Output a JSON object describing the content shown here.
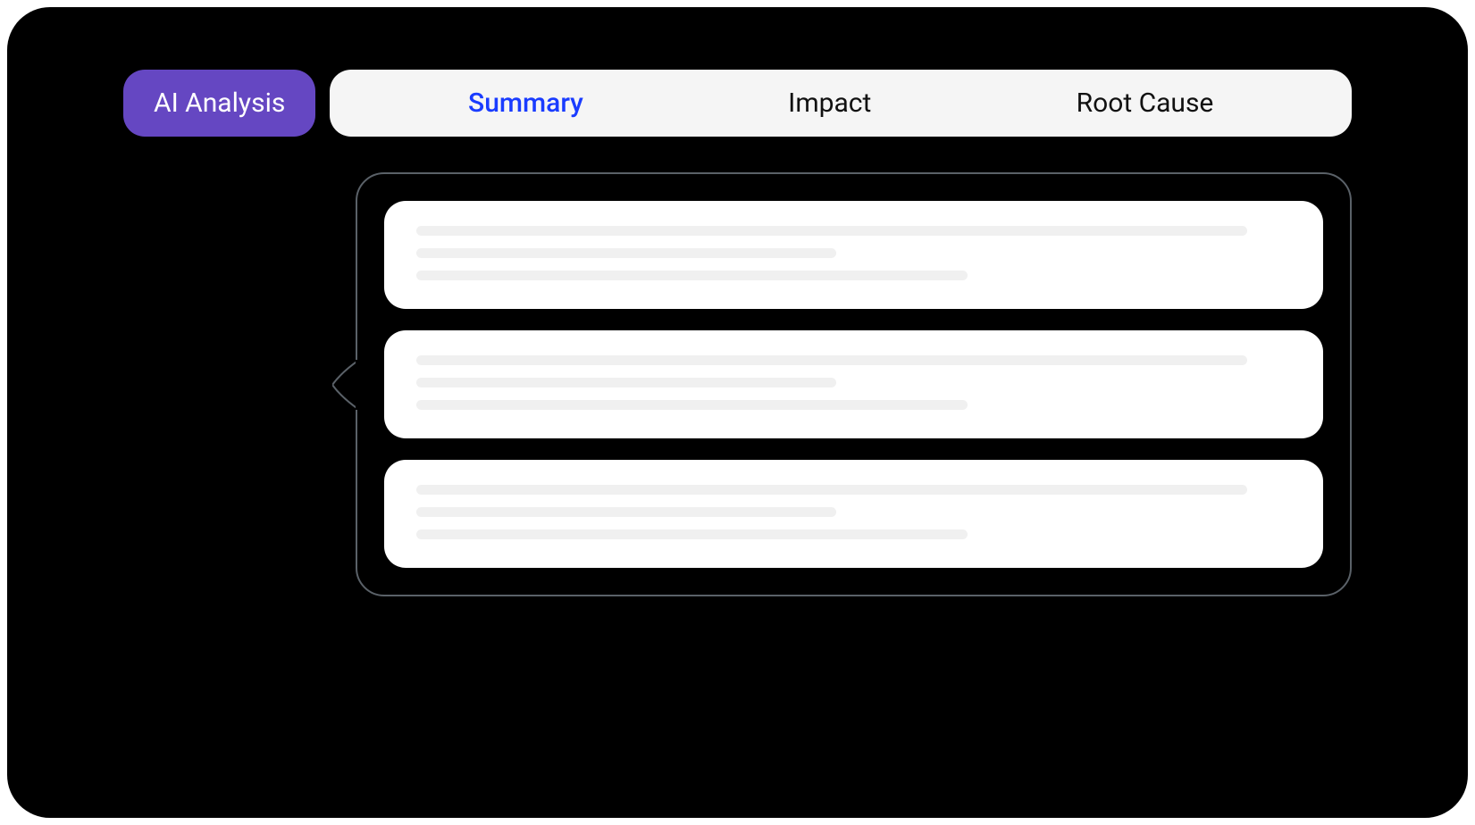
{
  "header": {
    "badge_label": "AI Analysis",
    "tabs": [
      {
        "label": "Summary",
        "active": true
      },
      {
        "label": "Impact",
        "active": false
      },
      {
        "label": "Root Cause",
        "active": false
      }
    ]
  },
  "colors": {
    "badge_bg": "#6547C2",
    "active_tab": "#1A3CFF",
    "frame_bg": "#000000",
    "tabs_bg": "#f5f5f5",
    "outline": "#5a6168"
  },
  "content": {
    "cards": [
      {
        "skeleton_lines": [
          "long",
          "med",
          "med2"
        ]
      },
      {
        "skeleton_lines": [
          "long",
          "med",
          "med2"
        ]
      },
      {
        "skeleton_lines": [
          "long",
          "med",
          "med2"
        ]
      }
    ]
  }
}
